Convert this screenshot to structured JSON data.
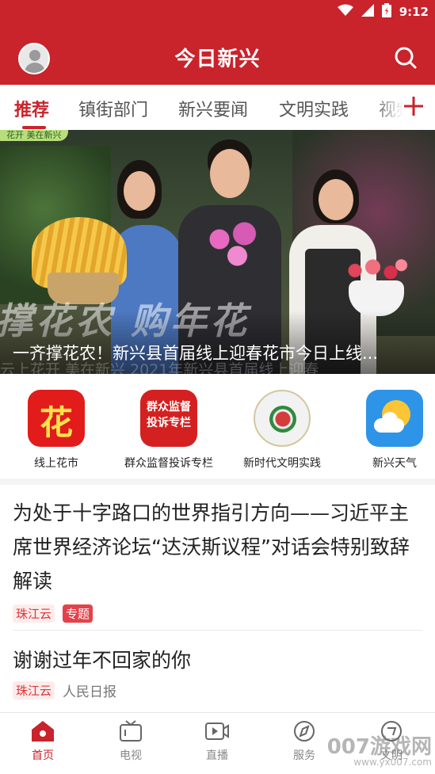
{
  "status_bar": {
    "time": "9:12",
    "icons": [
      "wifi-icon",
      "signal-icon",
      "battery-icon"
    ]
  },
  "header": {
    "title": "今日新兴"
  },
  "tabs": [
    {
      "label": "推荐",
      "active": true
    },
    {
      "label": "镇街部门"
    },
    {
      "label": "新兴要闻"
    },
    {
      "label": "文明实践"
    },
    {
      "label": "视频"
    }
  ],
  "banner": {
    "top_badge": "花开 美在新兴",
    "slogan": "撑花农 购年花",
    "caption": "一齐撑花农！新兴县首届线上迎春花市今日上线...",
    "watermark": "云上花开 美在新兴   2021年新兴县首届线上迎春"
  },
  "shortcuts": [
    {
      "label": "线上花市",
      "icon_text": "花",
      "icon": "flower-market-icon"
    },
    {
      "label": "群众监督投诉专栏",
      "icon_lines": [
        "群众监督",
        "投诉专栏"
      ],
      "icon": "complaint-icon"
    },
    {
      "label": "新时代文明实践",
      "icon": "civilization-emblem-icon"
    },
    {
      "label": "新兴天气",
      "icon": "weather-icon"
    }
  ],
  "articles": [
    {
      "title": "为处于十字路口的世界指引方向——习近平主席世界经济论坛“达沃斯议程”对话会特别致辞解读",
      "source": "珠江云",
      "tag": "专题"
    },
    {
      "title": "谢谢过年不回家的你",
      "source": "珠江云",
      "publisher": "人民日报"
    }
  ],
  "bottom_nav": [
    {
      "label": "首页",
      "icon": "home-icon",
      "active": true
    },
    {
      "label": "电视",
      "icon": "tv-icon"
    },
    {
      "label": "直播",
      "icon": "live-icon"
    },
    {
      "label": "服务",
      "icon": "compass-icon"
    },
    {
      "label": "文明",
      "icon": "civilization-icon"
    }
  ],
  "watermark": {
    "text": "007游戏网",
    "sub": "www.yx007.com"
  },
  "colors": {
    "brand": "#c9232b"
  }
}
